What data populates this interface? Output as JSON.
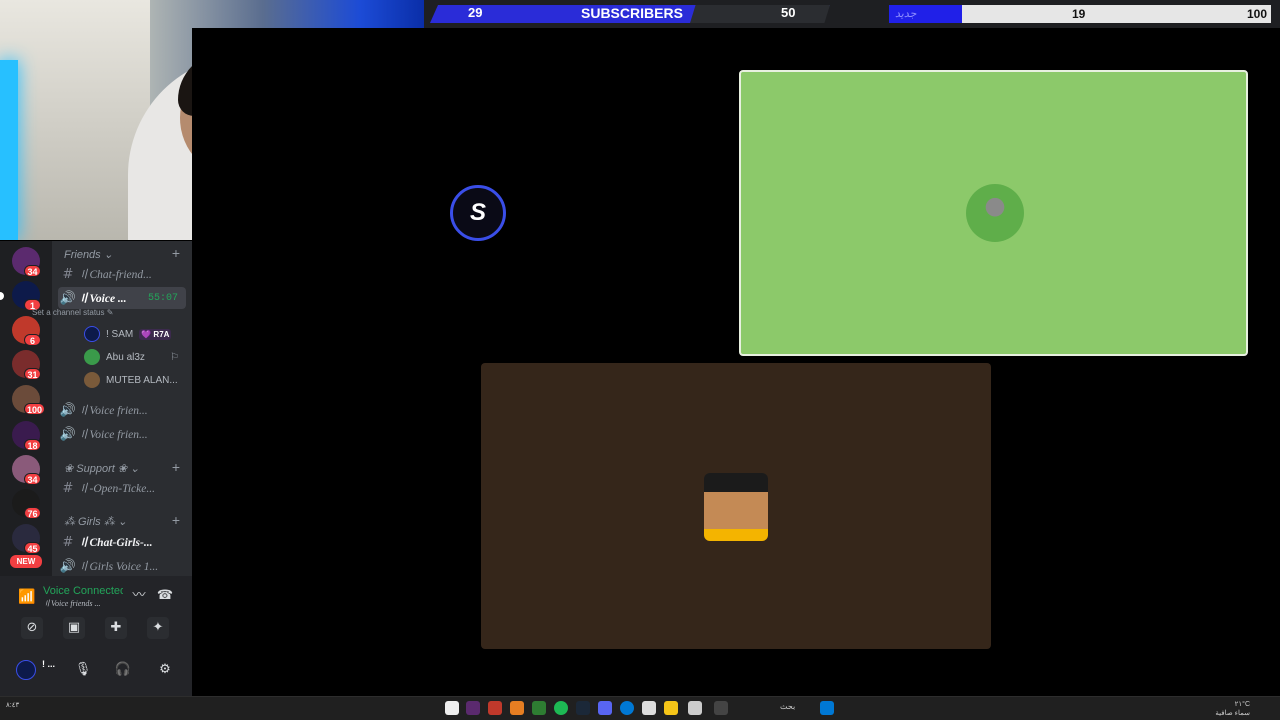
{
  "stats": {
    "subscribers_count": "29",
    "subscribers_label": "SUBSCRIBERS",
    "subscribers_goal": "50",
    "secondary_label": "جديد",
    "secondary_count": "19",
    "secondary_goal": "100",
    "secondary_progress": 0.19,
    "colors": {
      "accent": "#2a2cd8",
      "bar_bg": "#e6e6e6"
    }
  },
  "stage": {
    "server_badge": "S",
    "tiles": [
      {
        "name": "user-tile-green",
        "color": "#8cc96a"
      },
      {
        "name": "user-tile-brown",
        "color": "#35261a"
      }
    ]
  },
  "rail": {
    "servers": [
      {
        "badge": "34",
        "color": "#5b2a6e"
      },
      {
        "badge": "1",
        "color": "#0d1a4a"
      },
      {
        "badge": "6",
        "color": "#c0392b"
      },
      {
        "badge": "31",
        "color": "#7a2c2c"
      },
      {
        "badge": "100",
        "color": "#6b4b3a"
      },
      {
        "badge": "18",
        "color": "#3a1b4e"
      },
      {
        "badge": "34",
        "color": "#8a5a7a"
      },
      {
        "badge": "76",
        "color": "#1b1b1b"
      },
      {
        "badge": "45",
        "color": "#2a2a3e"
      }
    ],
    "new_label": "NEW"
  },
  "channels": {
    "cat_friends": "Friends ⌄",
    "ch_chat_friends": "〢Chat-friend...",
    "ch_voice_active": "〢Voice ...",
    "timer": "55:07",
    "status_hint": "Set a channel status ✎",
    "users": [
      {
        "name": "! SAM",
        "tag": "💜 R7A",
        "color": "#0d1a4a"
      },
      {
        "name": "Abu al3z",
        "tag": "",
        "color": "#3a9a4a"
      },
      {
        "name": "MUTEB ALAN...",
        "tag": "",
        "color": "#7a5a3a"
      }
    ],
    "ch_voice_friends_2": "〢Voice frien...",
    "ch_voice_friends_3": "〢Voice frien...",
    "cat_support": "❀ Support ❀ ⌄",
    "ch_open_ticket": "〢-Open-Ticke...",
    "cat_girls": "⁂ Girls ⁂ ⌄",
    "ch_chat_girls": "〢Chat-Girls-...",
    "ch_girls_voice": "〢Girls Voice 1..."
  },
  "voice": {
    "title": "Voice Connected",
    "subtitle": "〢Voice friends ...",
    "me_name": "! ..."
  },
  "taskbar": {
    "left_text": "٨:٤٣",
    "search_label": "بحث",
    "right_line1": "٢١°C",
    "right_line2": "سماء صافية"
  }
}
